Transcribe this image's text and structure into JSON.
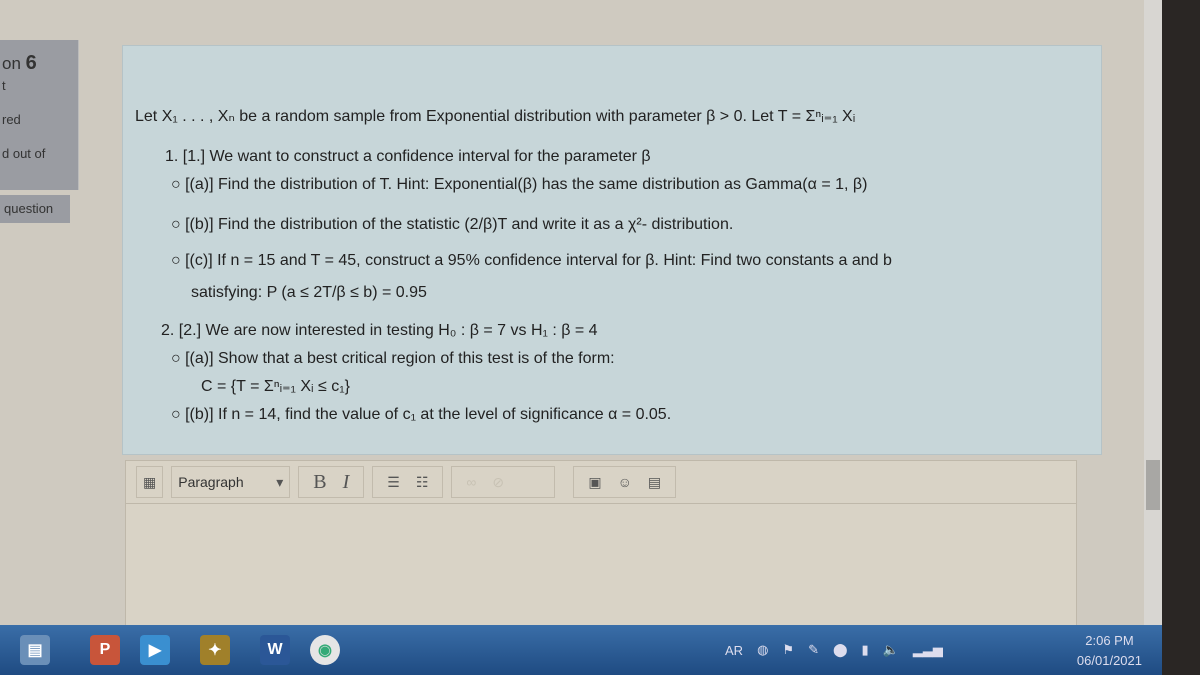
{
  "sidebar": {
    "question_prefix": "on",
    "question_number": "6",
    "status_a": "t",
    "status_b": "red",
    "marked": "d out of",
    "flag": "question"
  },
  "question": {
    "intro": "Let X₁ . . . , Xₙ be a random sample from Exponential distribution with parameter β > 0. Let T = Σⁿᵢ₌₁ Xᵢ",
    "p1": "1. [1.] We want to construct a confidence interval for the parameter β",
    "p1a": "[(a)] Find the distribution of T. Hint: Exponential(β) has the same distribution as Gamma(α = 1, β)",
    "p1b": "[(b)] Find the distribution of the statistic (2/β)T and write it as a χ²- distribution.",
    "p1c": "[(c)] If n = 15 and T = 45, construct a 95% confidence interval for β. Hint: Find two constants a and b",
    "p1c2": "satisfying: P (a ≤ 2T/β ≤ b) = 0.95",
    "p2": "2. [2.] We are now interested in testing H₀ : β = 7 vs H₁ : β = 4",
    "p2a": "[(a)] Show that a best critical region of this test is of the form:",
    "p2a2": "C = {T = Σⁿᵢ₌₁ Xᵢ ≤ c₁}",
    "p2b": "[(b)] If n = 14, find the value of c₁ at the level of significance α = 0.05."
  },
  "editor": {
    "format": "Paragraph",
    "bold": "B",
    "italic": "I",
    "content": ""
  },
  "taskbar": {
    "lang": "AR",
    "time": "2:06 PM",
    "date": "06/01/2021",
    "apps": [
      "P",
      "W"
    ]
  }
}
